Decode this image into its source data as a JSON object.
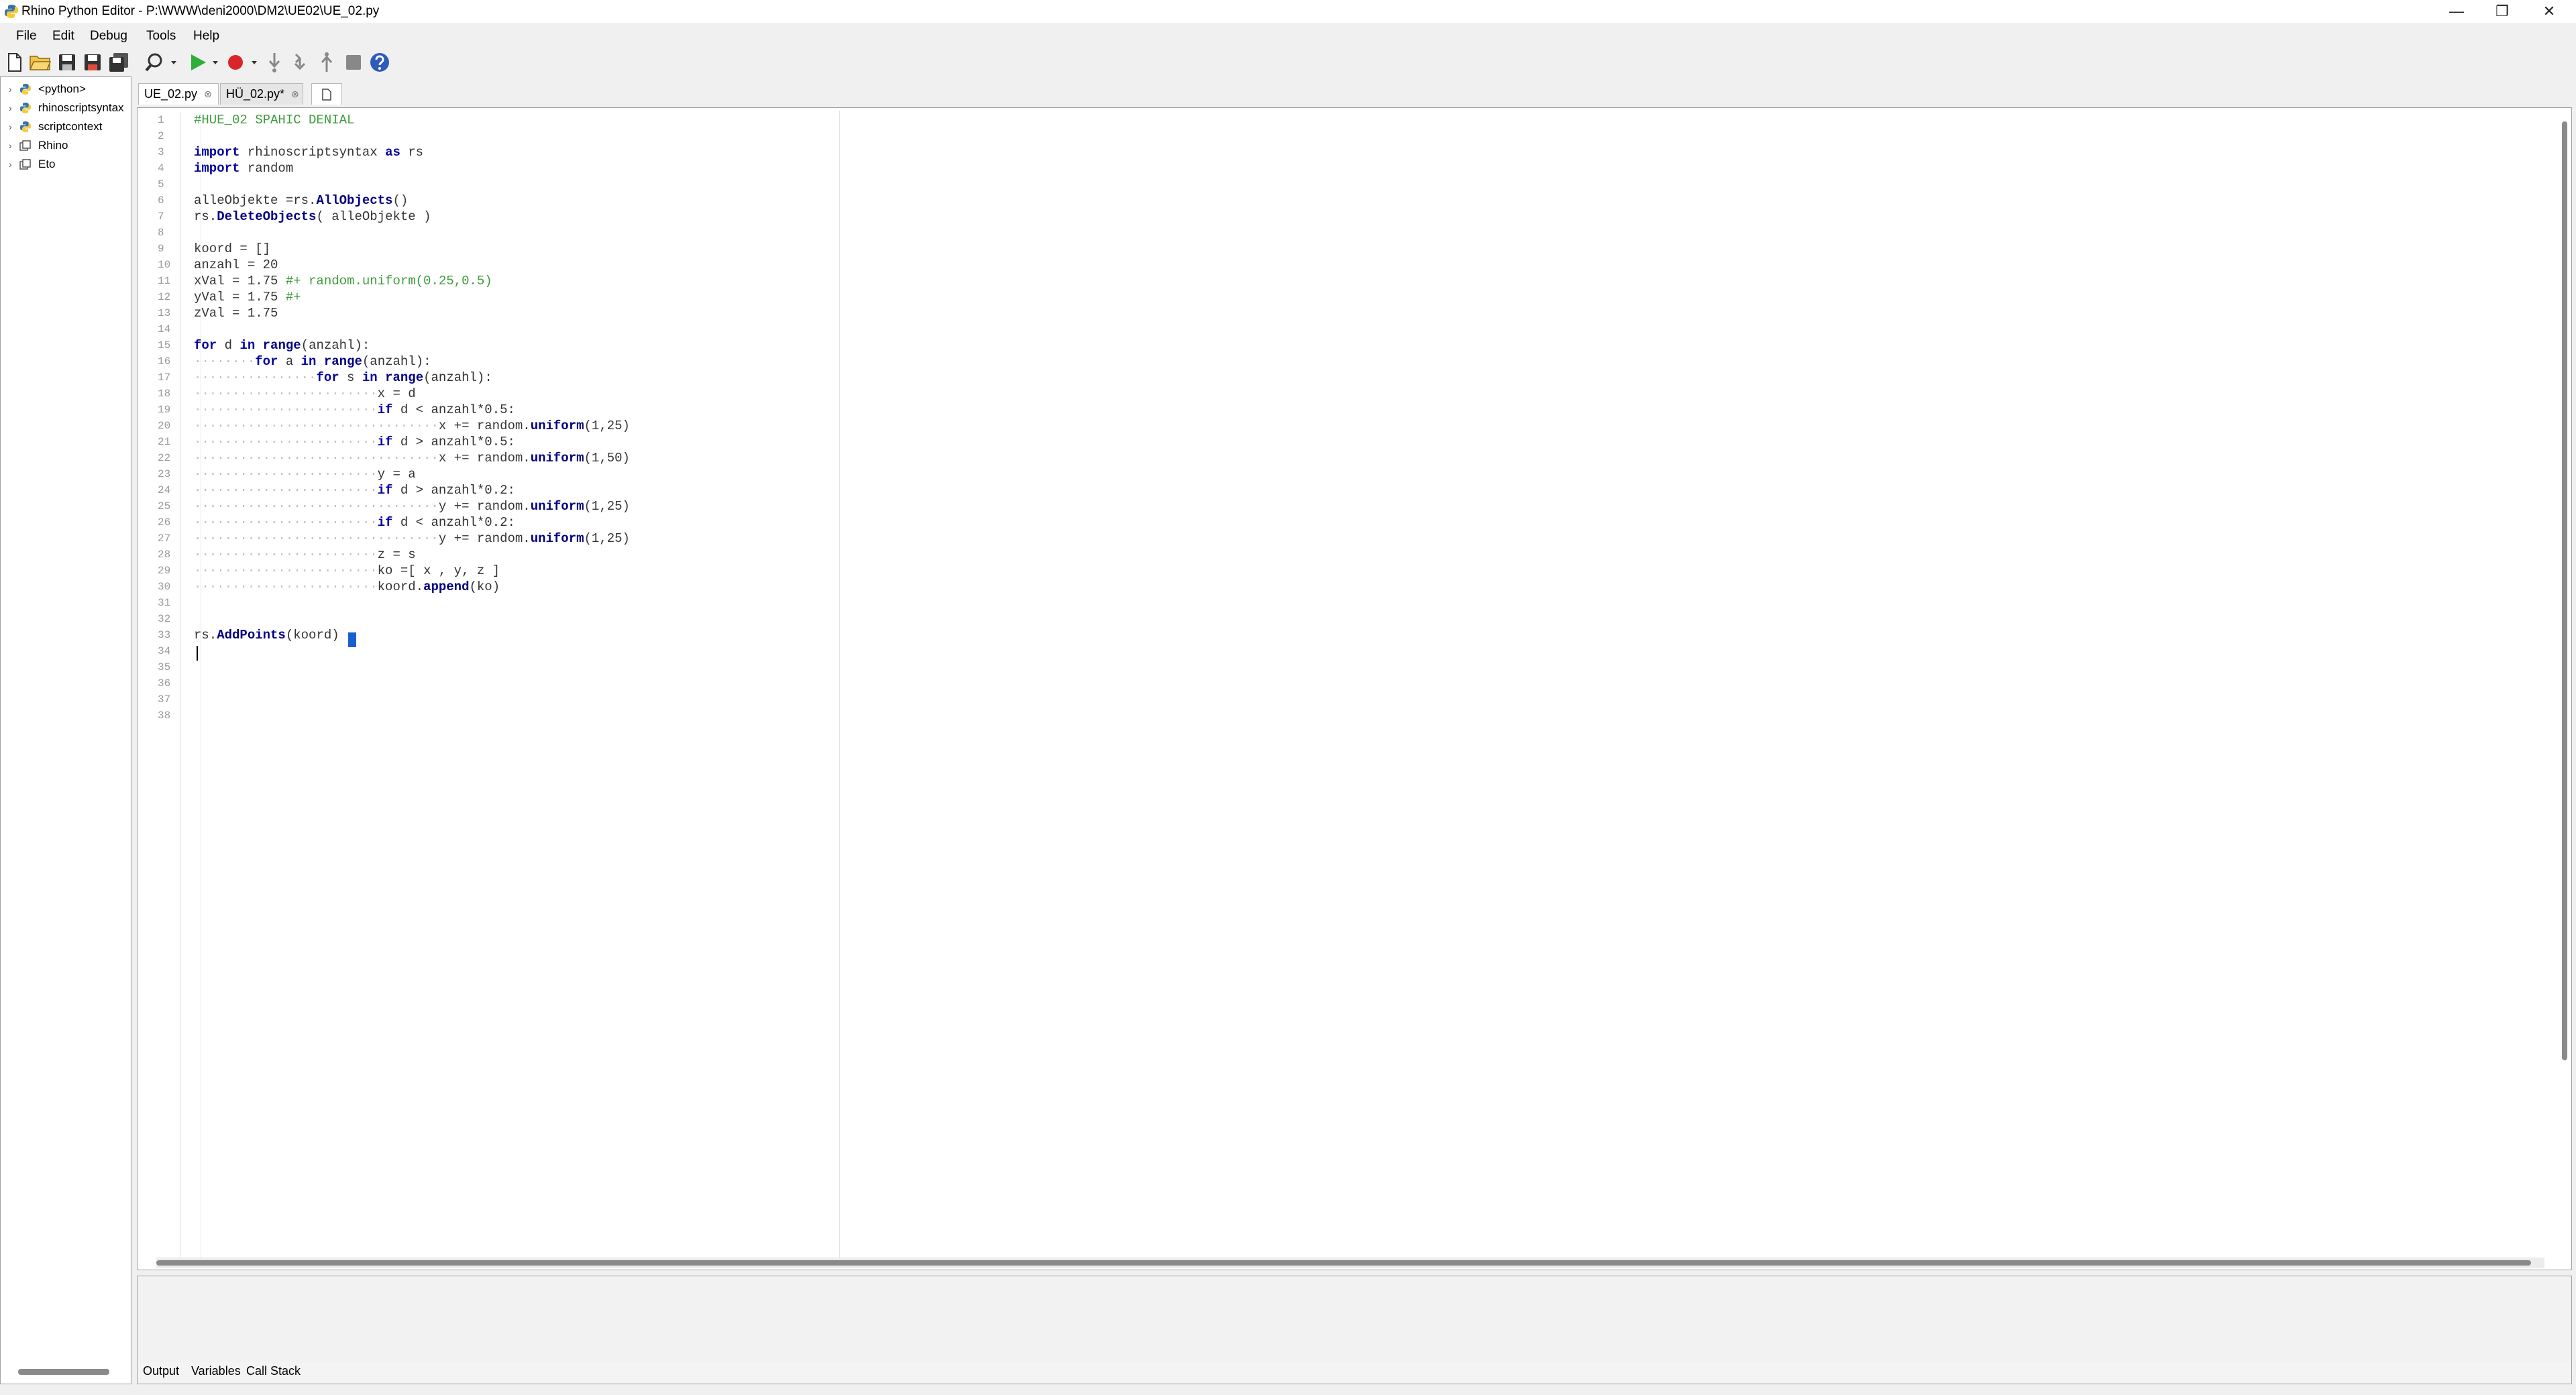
{
  "window": {
    "title": "Rhino Python Editor - P:\\WWW\\deni2000\\DM2\\UE02\\UE_02.py",
    "controls": {
      "minimize": "—",
      "maximize": "❐",
      "close": "✕"
    }
  },
  "menu": {
    "items": [
      "File",
      "Edit",
      "Debug",
      "Tools",
      "Help"
    ]
  },
  "toolbar": {
    "buttons": [
      "new-file-icon",
      "open-folder-icon",
      "save-icon",
      "save-as-icon",
      "save-all-icon",
      "find-icon",
      "run-icon",
      "record-breakpoint-icon",
      "step-into-icon",
      "step-over-icon",
      "step-out-icon",
      "stop-icon",
      "help-icon"
    ]
  },
  "tree": {
    "items": [
      {
        "label": "<python>",
        "icon": "python-icon"
      },
      {
        "label": "rhinoscriptsyntax",
        "icon": "python-icon"
      },
      {
        "label": "scriptcontext",
        "icon": "python-icon"
      },
      {
        "label": "Rhino",
        "icon": "namespace-icon"
      },
      {
        "label": "Eto",
        "icon": "namespace-icon"
      }
    ]
  },
  "tabs": [
    {
      "label": "UE_02.py",
      "close": "⊗",
      "active": true
    },
    {
      "label": "HÜ_02.py*",
      "close": "⊗",
      "active": false
    }
  ],
  "editor": {
    "line_count": 38,
    "lines": [
      "#HUE_02 SPAHIC DENIAL",
      "",
      "import rhinoscriptsyntax as rs",
      "import random",
      "",
      "alleObjekte =rs.AllObjects()",
      "rs.DeleteObjects( alleObjekte )",
      "",
      "koord = []",
      "anzahl = 20",
      "xVal = 1.75 #+ random.uniform(0.25,0.5)",
      "yVal = 1.75 #+",
      "zVal = 1.75",
      "",
      "for d in range(anzahl):",
      "    for a in range(anzahl):",
      "        for s in range(anzahl):",
      "            x = d",
      "            if d < anzahl*0.5:",
      "                x += random.uniform(1,25)",
      "            if d > anzahl*0.5:",
      "                x += random.uniform(1,50)",
      "            y = a",
      "            if d > anzahl*0.2:",
      "                y += random.uniform(1,25)",
      "            if d < anzahl*0.2:",
      "                y += random.uniform(1,25)",
      "            z = s",
      "            ko =[ x , y, z ]",
      "            koord.append(ko)",
      "",
      "",
      "rs.AddPoints(koord)",
      "",
      "",
      "",
      "",
      ""
    ]
  },
  "output": {
    "tabs": [
      "Output",
      "Variables",
      "Call Stack"
    ]
  },
  "colors": {
    "keyword": "#0000a0",
    "comment": "#3c9b3c",
    "selection": "#1a5fd0"
  }
}
